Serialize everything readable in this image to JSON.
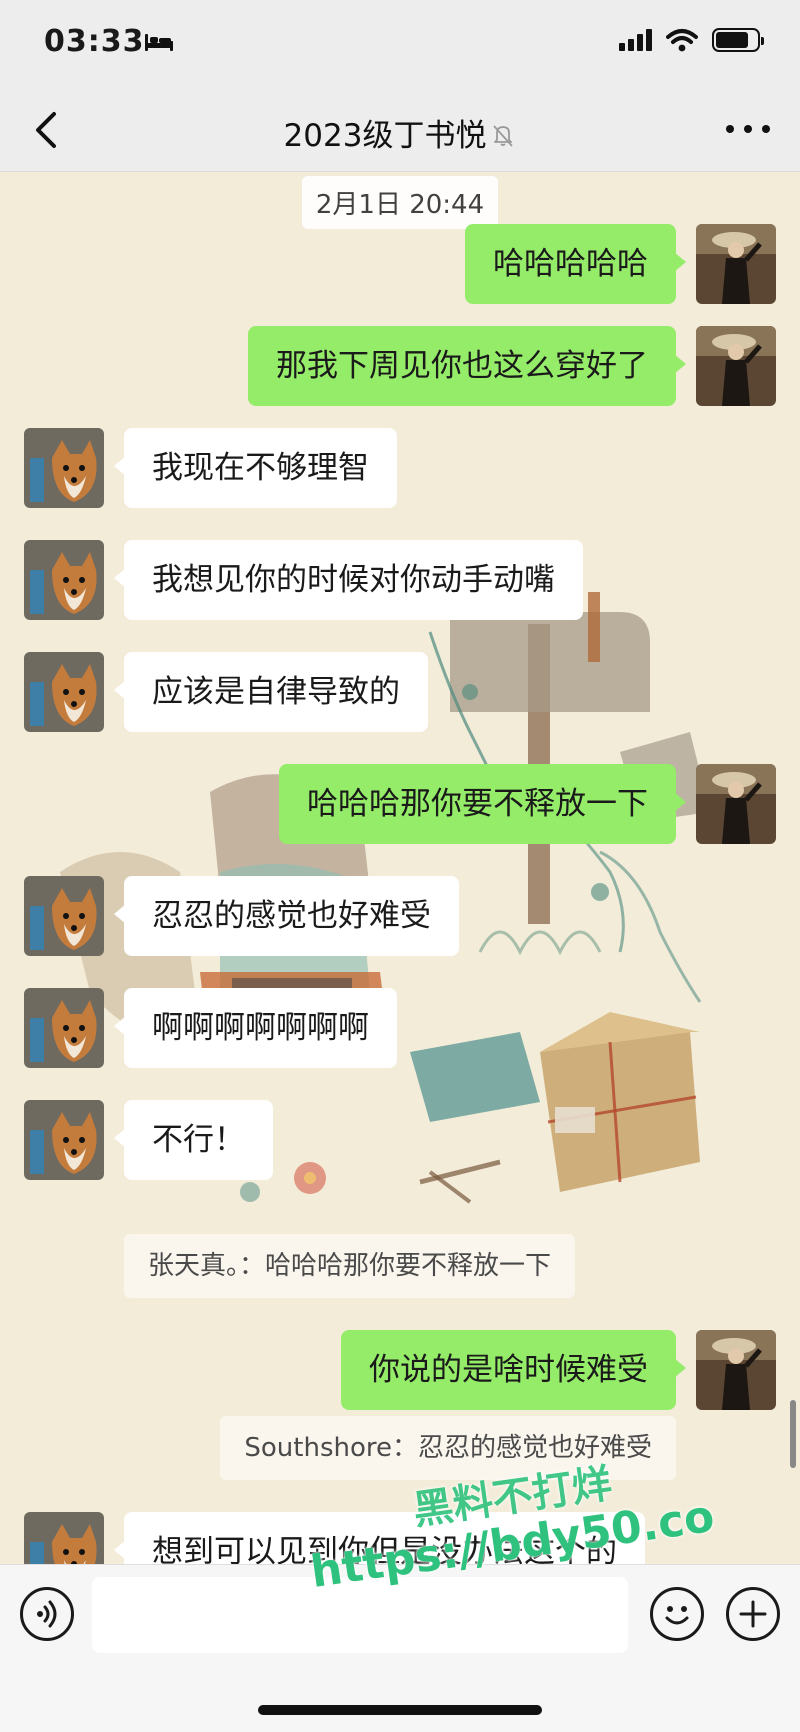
{
  "status_bar": {
    "time": "03:33"
  },
  "header": {
    "title": "2023级丁书悦"
  },
  "chat": {
    "timestamp": "2月1日 20:44",
    "messages": [
      {
        "from": "me",
        "text": "哈哈哈哈哈"
      },
      {
        "from": "me",
        "text": "那我下周见你也这么穿好了"
      },
      {
        "from": "other",
        "text": "我现在不够理智"
      },
      {
        "from": "other",
        "text": "我想见你的时候对你动手动嘴"
      },
      {
        "from": "other",
        "text": "应该是自律导致的"
      },
      {
        "from": "me",
        "text": "哈哈哈那你要不释放一下"
      },
      {
        "from": "other",
        "text": "忍忍的感觉也好难受"
      },
      {
        "from": "other",
        "text": "啊啊啊啊啊啊啊"
      },
      {
        "from": "other",
        "text": "不行！",
        "quote": "张天真。：哈哈哈那你要不释放一下"
      },
      {
        "from": "me",
        "text": "你说的是啥时候难受",
        "quote": "Southshore：忍忍的感觉也好难受"
      },
      {
        "from": "other",
        "text": "想到可以见到你但是没办法这个的"
      }
    ]
  },
  "watermark": {
    "line1": "黑料不打烊",
    "line2": "https://bdy50.co"
  },
  "colors": {
    "my_bubble": "#95ec69",
    "other_bubble": "#ffffff",
    "background": "#f3ecd9",
    "bar": "#ededed"
  }
}
